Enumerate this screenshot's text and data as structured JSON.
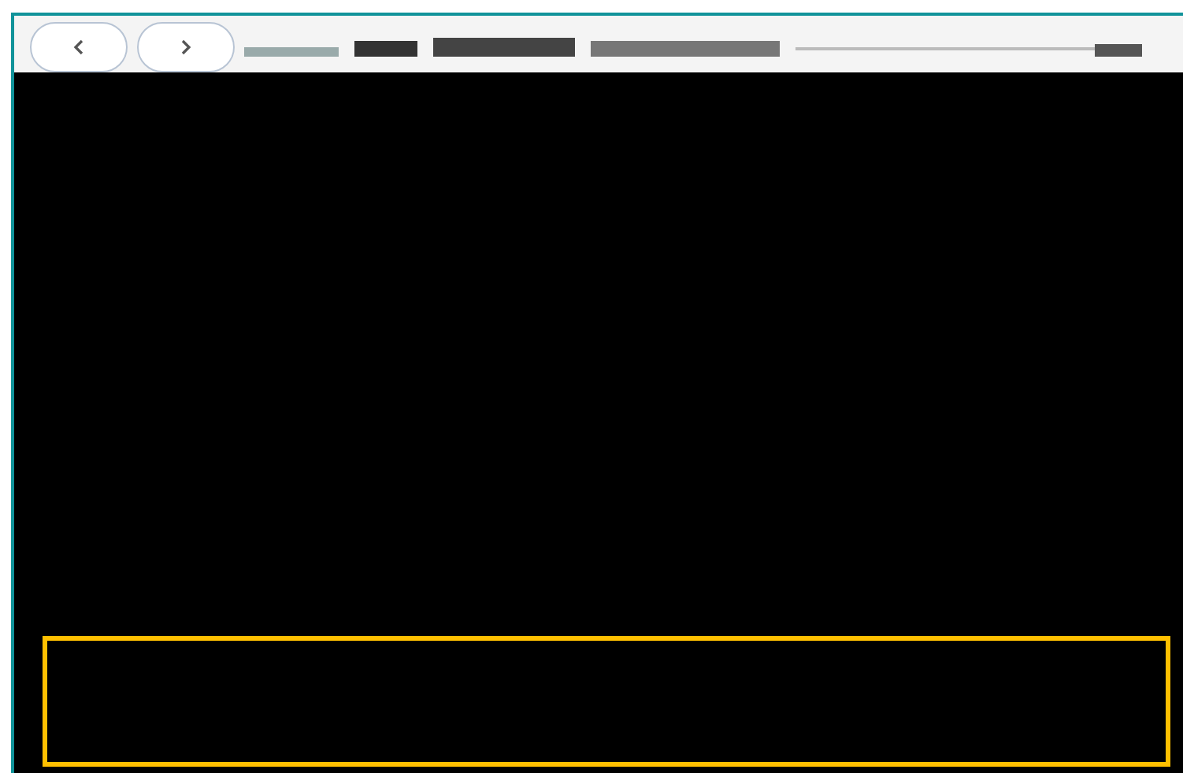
{
  "toolbar": {
    "buttons": [
      {
        "kind": "back"
      },
      {
        "kind": "forward"
      }
    ]
  }
}
